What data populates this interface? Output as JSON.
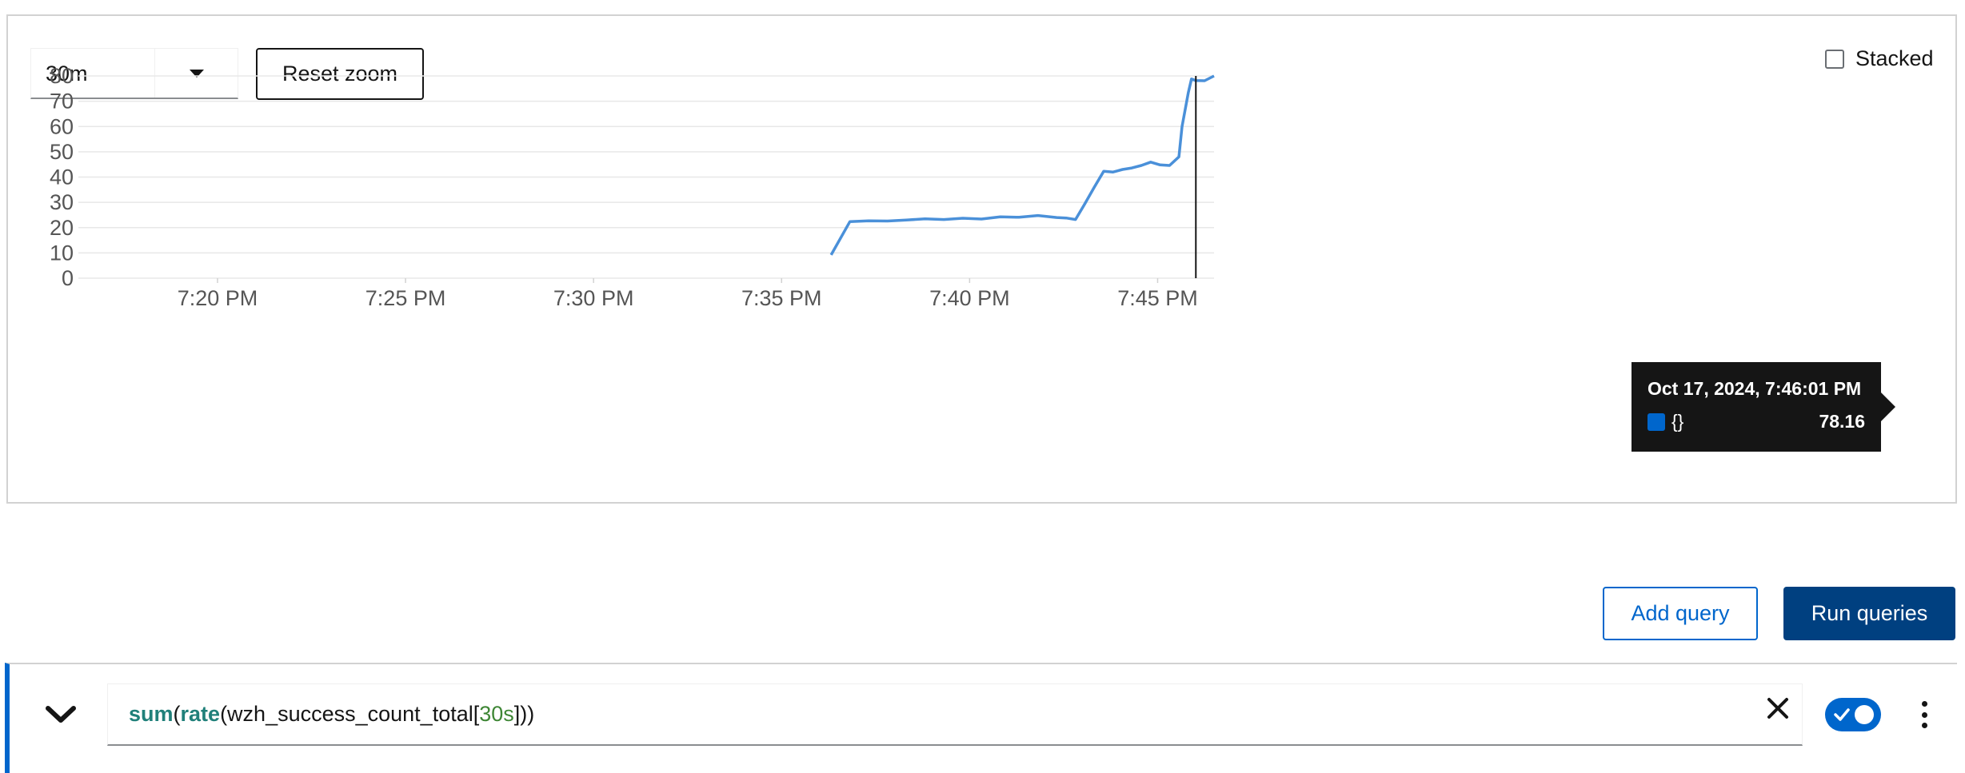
{
  "controls": {
    "range_value": "30m",
    "reset_zoom_label": "Reset zoom",
    "stacked_label": "Stacked",
    "stacked_checked": false
  },
  "tooltip": {
    "time": "Oct 17, 2024, 7:46:01 PM",
    "series_label": "{}",
    "value": "78.16",
    "swatch_color": "#0066cc"
  },
  "buttons": {
    "add_query_label": "Add query",
    "run_queries_label": "Run queries"
  },
  "query": {
    "tokens": [
      {
        "text": "sum",
        "kind": "fn"
      },
      {
        "text": "(",
        "kind": "plain"
      },
      {
        "text": "rate",
        "kind": "fn"
      },
      {
        "text": "(wzh_success_count_total[",
        "kind": "plain"
      },
      {
        "text": "30s",
        "kind": "num"
      },
      {
        "text": "]))",
        "kind": "plain"
      }
    ],
    "enabled": true
  },
  "chart_data": {
    "type": "line",
    "x_unit": "time (PM, Oct 17, 2024)",
    "x_range": [
      "7:16:18 PM",
      "7:46:30 PM"
    ],
    "y_range": [
      0,
      80
    ],
    "y_ticks": [
      "0",
      "10",
      "20",
      "30",
      "40",
      "50",
      "60",
      "70",
      "80"
    ],
    "x_ticks": [
      "7:20 PM",
      "7:25 PM",
      "7:30 PM",
      "7:35 PM",
      "7:40 PM",
      "7:45 PM"
    ],
    "grid": true,
    "line_color": "#4a90d9",
    "hover_time": "7:46:01 PM",
    "series": [
      {
        "points": [
          [
            "7:36:19 PM",
            9.2
          ],
          [
            "7:36:49 PM",
            22.4
          ],
          [
            "7:37:19 PM",
            22.7
          ],
          [
            "7:37:49 PM",
            22.6
          ],
          [
            "7:38:19 PM",
            23.0
          ],
          [
            "7:38:49 PM",
            23.5
          ],
          [
            "7:39:19 PM",
            23.2
          ],
          [
            "7:39:49 PM",
            23.7
          ],
          [
            "7:40:19 PM",
            23.4
          ],
          [
            "7:40:49 PM",
            24.3
          ],
          [
            "7:41:19 PM",
            24.1
          ],
          [
            "7:41:49 PM",
            24.8
          ],
          [
            "7:42:19 PM",
            24.0
          ],
          [
            "7:42:34 PM",
            23.8
          ],
          [
            "7:42:49 PM",
            23.2
          ],
          [
            "7:43:04 PM",
            29.5
          ],
          [
            "7:43:19 PM",
            36.0
          ],
          [
            "7:43:34 PM",
            42.3
          ],
          [
            "7:43:49 PM",
            42.0
          ],
          [
            "7:44:04 PM",
            43.0
          ],
          [
            "7:44:19 PM",
            43.6
          ],
          [
            "7:44:34 PM",
            44.6
          ],
          [
            "7:44:49 PM",
            45.9
          ],
          [
            "7:45:04 PM",
            44.8
          ],
          [
            "7:45:19 PM",
            44.6
          ],
          [
            "7:45:34 PM",
            48.0
          ],
          [
            "7:45:39 PM",
            60.0
          ],
          [
            "7:45:49 PM",
            73.5
          ],
          [
            "7:45:54 PM",
            78.8
          ],
          [
            "7:46:01 PM",
            78.16
          ],
          [
            "7:46:15 PM",
            78.1
          ],
          [
            "7:46:30 PM",
            80.0
          ]
        ]
      }
    ]
  }
}
